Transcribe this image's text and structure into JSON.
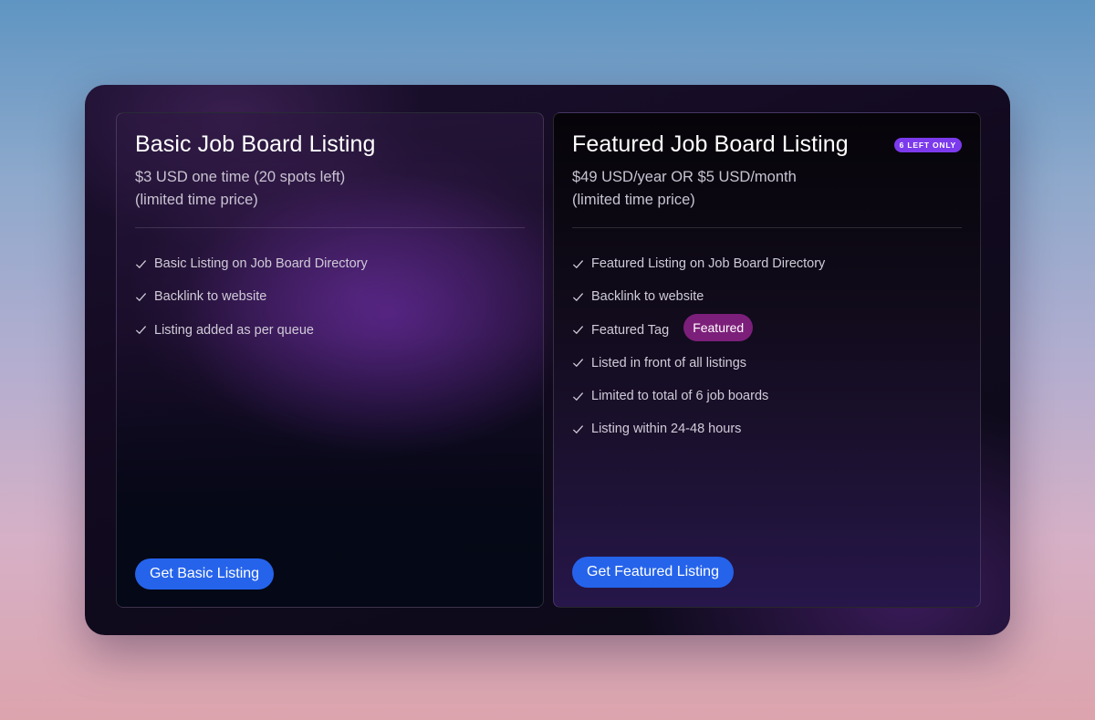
{
  "plans": {
    "basic": {
      "title": "Basic Job Board Listing",
      "price_line1": "$3 USD one time (20 spots left)",
      "price_line2": "(limited time price)",
      "features": [
        "Basic Listing on Job Board Directory",
        "Backlink to website",
        "Listing added as per queue"
      ],
      "cta_label": "Get Basic Listing"
    },
    "featured": {
      "title": "Featured Job Board Listing",
      "badge": "6 LEFT ONLY",
      "price_line1": "$49 USD/year OR $5 USD/month",
      "price_line2": "(limited time price)",
      "features": [
        "Featured Listing on Job Board Directory",
        "Backlink to website",
        "Featured Tag",
        "Listed in front of all listings",
        "Limited to total of 6 job boards",
        "Listing within 24-48 hours"
      ],
      "tag_example": "Featured",
      "cta_label": "Get Featured Listing"
    }
  },
  "icons": {
    "feature_bullet": "check-icon"
  },
  "colors": {
    "button": "#2563eb",
    "badge": "#7c3aed",
    "featured_tag": "#7c1f7a"
  }
}
